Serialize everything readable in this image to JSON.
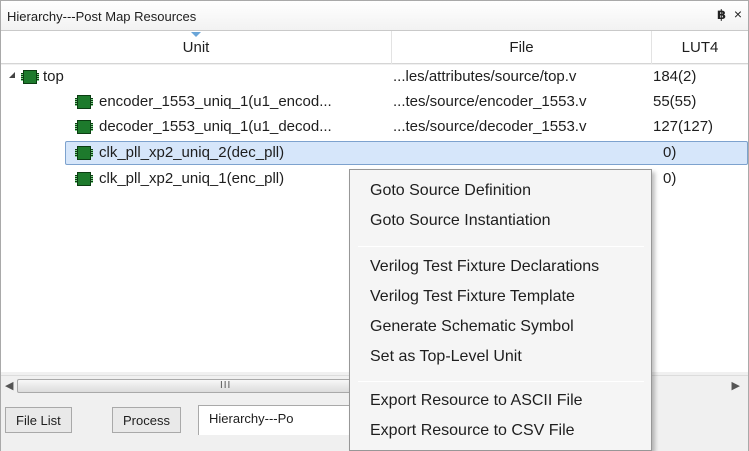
{
  "window": {
    "title": "Hierarchy---Post Map Resources",
    "float_icon": "restore-icon",
    "close_icon": "close-icon",
    "float_glyph": "฿",
    "close_glyph": "×"
  },
  "columns": {
    "unit": "Unit",
    "file": "File",
    "lut": "LUT4"
  },
  "rows": [
    {
      "unit": "top",
      "file": "...les/attributes/source/top.v",
      "lut": "184(2)"
    },
    {
      "unit": "encoder_1553_uniq_1(u1_encod...",
      "file": "...tes/source/encoder_1553.v",
      "lut": "55(55)"
    },
    {
      "unit": "decoder_1553_uniq_1(u1_decod...",
      "file": "...tes/source/decoder_1553.v",
      "lut": "127(127)"
    },
    {
      "unit": "clk_pll_xp2_uniq_2(dec_pll)",
      "file": "",
      "lut": "0)"
    },
    {
      "unit": "clk_pll_xp2_uniq_1(enc_pll)",
      "file": "",
      "lut": "0)"
    }
  ],
  "scrollbar": {
    "grip": "III",
    "left_arrow": "◀",
    "right_arrow": "▶"
  },
  "tabs": [
    "File List",
    "Process",
    "Hierarchy---Po"
  ],
  "context_menu": {
    "items": [
      "Goto Source Definition",
      "Goto Source Instantiation",
      "Verilog Test Fixture Declarations",
      "Verilog Test Fixture Template",
      "Generate Schematic Symbol",
      "Set as Top-Level Unit",
      "Export Resource to ASCII File",
      "Export Resource to CSV File"
    ]
  },
  "colors": {
    "selection": "#d6e6fa",
    "chip": "#1d7a2c",
    "menu_bg": "#f5f5f5"
  }
}
